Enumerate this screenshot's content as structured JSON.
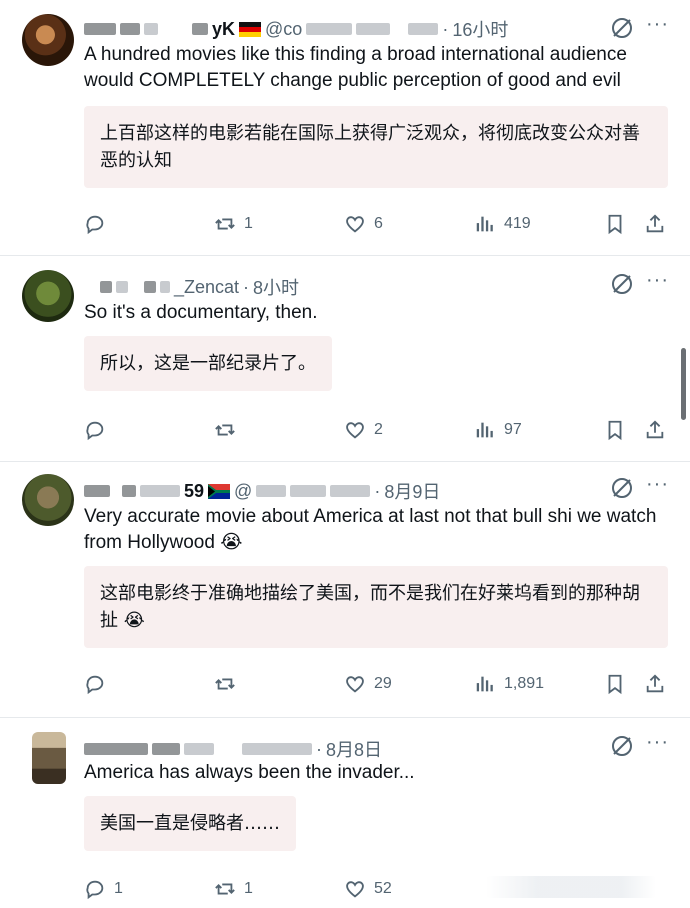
{
  "posts": [
    {
      "handle_visible": "@co",
      "name_tail": "yK",
      "time": "16小时",
      "text": "A hundred movies like this finding a broad international audience would COMPLETELY change public perception of good and evil",
      "translation": "上百部这样的电影若能在国际上获得广泛观众，将彻底改变公众对善恶的认知",
      "replies": "",
      "reposts": "1",
      "likes": "6",
      "views": "419"
    },
    {
      "name_tail": "_Zencat",
      "time": "8小时",
      "text": "So it's a documentary, then.",
      "translation": "所以，这是一部纪录片了。",
      "replies": "",
      "reposts": "",
      "likes": "2",
      "views": "97"
    },
    {
      "name_tail": "59",
      "handle_visible": "@",
      "time": "8月9日",
      "text": "Very accurate movie about America at last not that bull shi we watch from Hollywood 😭",
      "translation": "这部电影终于准确地描绘了美国，而不是我们在好莱坞看到的那种胡扯 😭",
      "replies": "",
      "reposts": "",
      "likes": "29",
      "views": "1,891"
    },
    {
      "time": "8月8日",
      "text": "America has always been the invader...",
      "translation": "美国一直是侵略者……",
      "replies": "1",
      "reposts": "1",
      "likes": "52",
      "views": ""
    }
  ],
  "colors": {
    "text": "#0f1419",
    "secondary": "#536471",
    "translation_bg": "#f8efef",
    "divider": "#e6e9ec"
  },
  "icons": [
    "reply-icon",
    "repost-icon",
    "like-icon",
    "views-icon",
    "bookmark-icon",
    "share-icon",
    "grok-icon",
    "more-icon"
  ]
}
